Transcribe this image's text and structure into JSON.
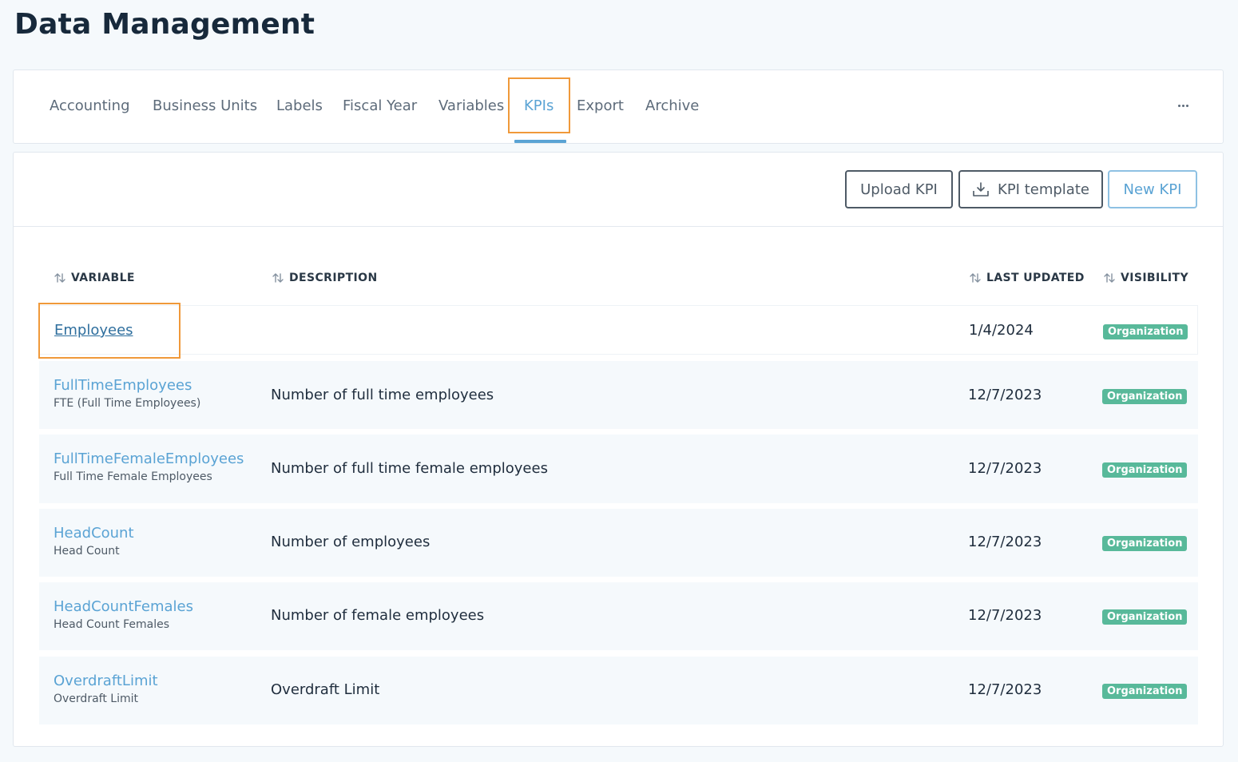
{
  "page": {
    "title": "Data Management"
  },
  "tabs": [
    {
      "label": "Accounting"
    },
    {
      "label": "Business Units"
    },
    {
      "label": "Labels"
    },
    {
      "label": "Fiscal Year"
    },
    {
      "label": "Variables"
    },
    {
      "label": "KPIs",
      "active": true
    },
    {
      "label": "Export"
    },
    {
      "label": "Archive"
    }
  ],
  "more_icon": "more-horizontal-icon",
  "toolbar": {
    "upload_label": "Upload KPI",
    "template_label": "KPI template",
    "template_icon": "download-icon",
    "new_label": "New KPI"
  },
  "table": {
    "headers": {
      "variable": "VARIABLE",
      "description": "DESCRIPTION",
      "last_updated": "LAST UPDATED",
      "visibility": "VISIBILITY"
    },
    "rows": [
      {
        "name": "Employees",
        "sub": "",
        "description": "",
        "last_updated": "1/4/2024",
        "visibility": "Organization"
      },
      {
        "name": "FullTimeEmployees",
        "sub": "FTE (Full Time Employees)",
        "description": "Number of full time employees",
        "last_updated": "12/7/2023",
        "visibility": "Organization"
      },
      {
        "name": "FullTimeFemaleEmployees",
        "sub": "Full Time Female Employees",
        "description": "Number of full time female employees",
        "last_updated": "12/7/2023",
        "visibility": "Organization"
      },
      {
        "name": "HeadCount",
        "sub": "Head Count",
        "description": "Number of employees",
        "last_updated": "12/7/2023",
        "visibility": "Organization"
      },
      {
        "name": "HeadCountFemales",
        "sub": "Head Count Females",
        "description": "Number of female employees",
        "last_updated": "12/7/2023",
        "visibility": "Organization"
      },
      {
        "name": "OverdraftLimit",
        "sub": "Overdraft Limit",
        "description": "Overdraft Limit",
        "last_updated": "12/7/2023",
        "visibility": "Organization"
      }
    ]
  },
  "colors": {
    "accent": "#5aa3d4",
    "highlight": "#f0993a",
    "badge": "#58b99a",
    "background": "#f5f9fc"
  }
}
